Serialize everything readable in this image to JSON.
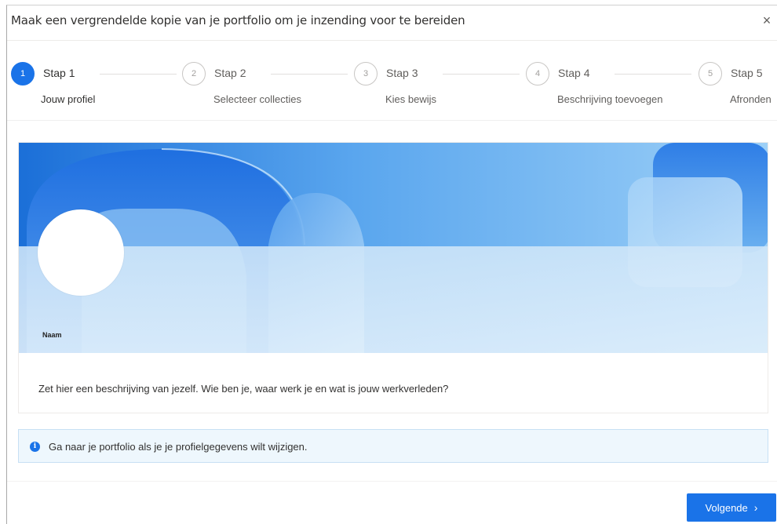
{
  "dialog": {
    "title": "Maak een vergrendelde kopie van je portfolio om je inzending voor te bereiden",
    "close_icon": "×"
  },
  "stepper": {
    "steps": [
      {
        "number": "1",
        "label": "Stap 1",
        "description": "Jouw profiel",
        "active": true
      },
      {
        "number": "2",
        "label": "Stap 2",
        "description": "Selecteer collecties",
        "active": false
      },
      {
        "number": "3",
        "label": "Stap 3",
        "description": "Kies bewijs",
        "active": false
      },
      {
        "number": "4",
        "label": "Stap 4",
        "description": "Beschrijving toevoegen",
        "active": false
      },
      {
        "number": "5",
        "label": "Stap 5",
        "description": "Afronden",
        "active": false
      }
    ]
  },
  "profile": {
    "name_label": "Naam",
    "description": "Zet hier een beschrijving van jezelf. Wie ben je, waar werk je en wat is jouw werkverleden?"
  },
  "info": {
    "icon": "i",
    "text": "Ga naar je portfolio als je je profielgegevens wilt wijzigen."
  },
  "footer": {
    "next_label": "Volgende",
    "next_icon": "›"
  },
  "colors": {
    "accent": "#1a73e8",
    "info_background": "#eef7fd",
    "info_border": "#c7e0f4"
  }
}
